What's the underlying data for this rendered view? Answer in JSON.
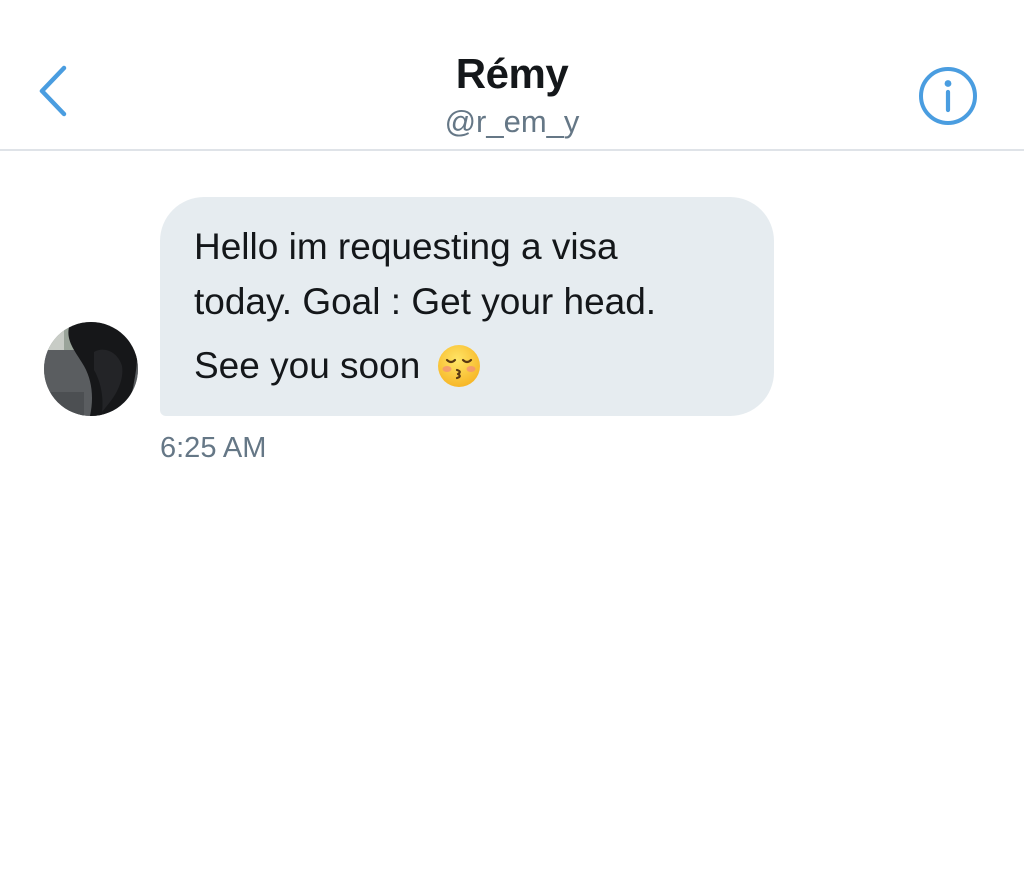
{
  "header": {
    "title": "Rémy",
    "handle": "@r_em_y",
    "back_icon": "chevron-left-icon",
    "info_icon": "info-circle-icon",
    "accent_color": "#4a9de0"
  },
  "conversation": {
    "messages": [
      {
        "sender": "Rémy",
        "lines": [
          "Hello im requesting a visa",
          "today. Goal : Get your head."
        ],
        "closing": "See you soon",
        "emoji": "kissing-face-with-closed-eyes-emoji",
        "timestamp": "6:25 AM",
        "bubble_color": "#e6ecf0"
      }
    ]
  }
}
